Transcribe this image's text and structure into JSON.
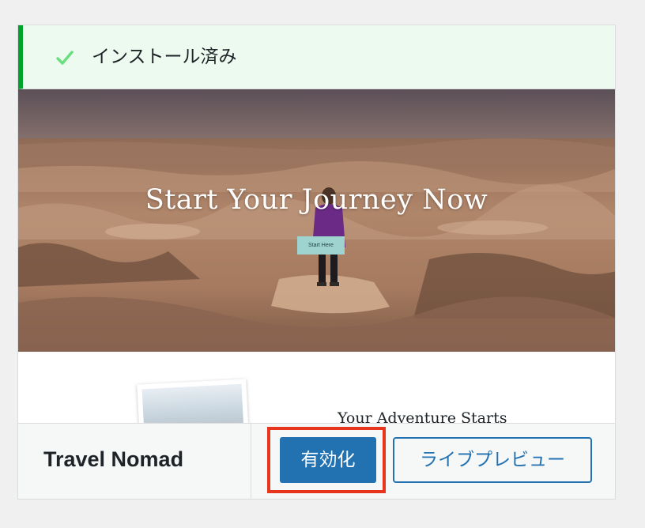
{
  "notice": {
    "icon": "check-icon",
    "text": "インストール済み",
    "color": "#00a32a",
    "background": "#edfaef"
  },
  "screenshot": {
    "hero_title": "Start Your Journey Now",
    "hero_button": "Start Here",
    "section_heading": "Your Adventure Starts"
  },
  "theme": {
    "name": "Travel Nomad"
  },
  "actions": {
    "activate_label": "有効化",
    "preview_label": "ライブプレビュー",
    "primary_color": "#2271b1",
    "highlight_color": "#e8351e"
  }
}
